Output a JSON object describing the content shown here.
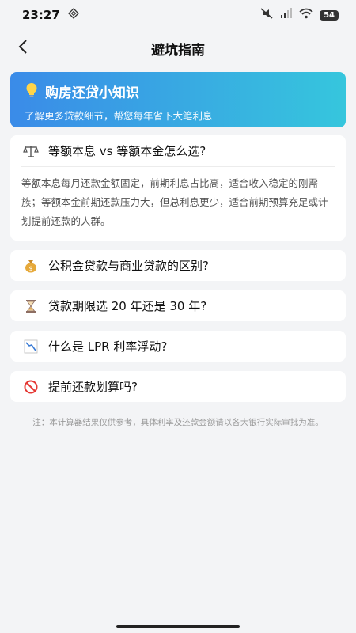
{
  "status_bar": {
    "time": "23:27",
    "battery": "54"
  },
  "header": {
    "title": "避坑指南"
  },
  "banner": {
    "title": "购房还贷小知识",
    "subtitle": "了解更多贷款细节，帮您每年省下大笔利息",
    "icon": "lightbulb-icon"
  },
  "faq": {
    "items": [
      {
        "icon": "scales-icon",
        "question": "等额本息 vs 等额本金怎么选?",
        "expanded": true,
        "answer": "等额本息每月还款金额固定，前期利息占比高，适合收入稳定的刚需族；等额本金前期还款压力大，但总利息更少，适合前期预算充足或计划提前还款的人群。"
      },
      {
        "icon": "money-bag-icon",
        "question": "公积金贷款与商业贷款的区别?",
        "expanded": false
      },
      {
        "icon": "hourglass-icon",
        "question": "贷款期限选 20 年还是 30 年?",
        "expanded": false
      },
      {
        "icon": "chart-down-icon",
        "question": "什么是 LPR 利率浮动?",
        "expanded": false
      },
      {
        "icon": "prohibited-icon",
        "question": "提前还款划算吗?",
        "expanded": false
      }
    ]
  },
  "note": "注：本计算器结果仅供参考，具体利率及还款金额请以各大银行实际审批为准。"
}
